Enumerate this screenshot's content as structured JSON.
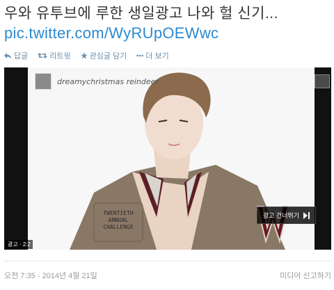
{
  "tweet": {
    "text": "우와 유투브에 루한 생일광고 나와 헐 신기...",
    "link": "pic.twitter.com/WyRUpOEWwc"
  },
  "actions": [
    {
      "label": "답글",
      "icon": "reply-icon"
    },
    {
      "label": "리트윗",
      "icon": "retweet-icon"
    },
    {
      "label": "관심글 담기",
      "icon": "star-icon"
    },
    {
      "label": "더 보기",
      "icon": "more-icon"
    }
  ],
  "video": {
    "channel_name": "dreamychristmas reindeer",
    "skip_label": "광고 건너뛰기",
    "ad_tag": "광고 · 2:2"
  },
  "footer": {
    "timestamp": "오전 7:35 - 2014년 4월 21일",
    "report": "미디어 신고하기"
  },
  "colors": {
    "link": "#2a8ad0",
    "action": "#6a8fae"
  }
}
